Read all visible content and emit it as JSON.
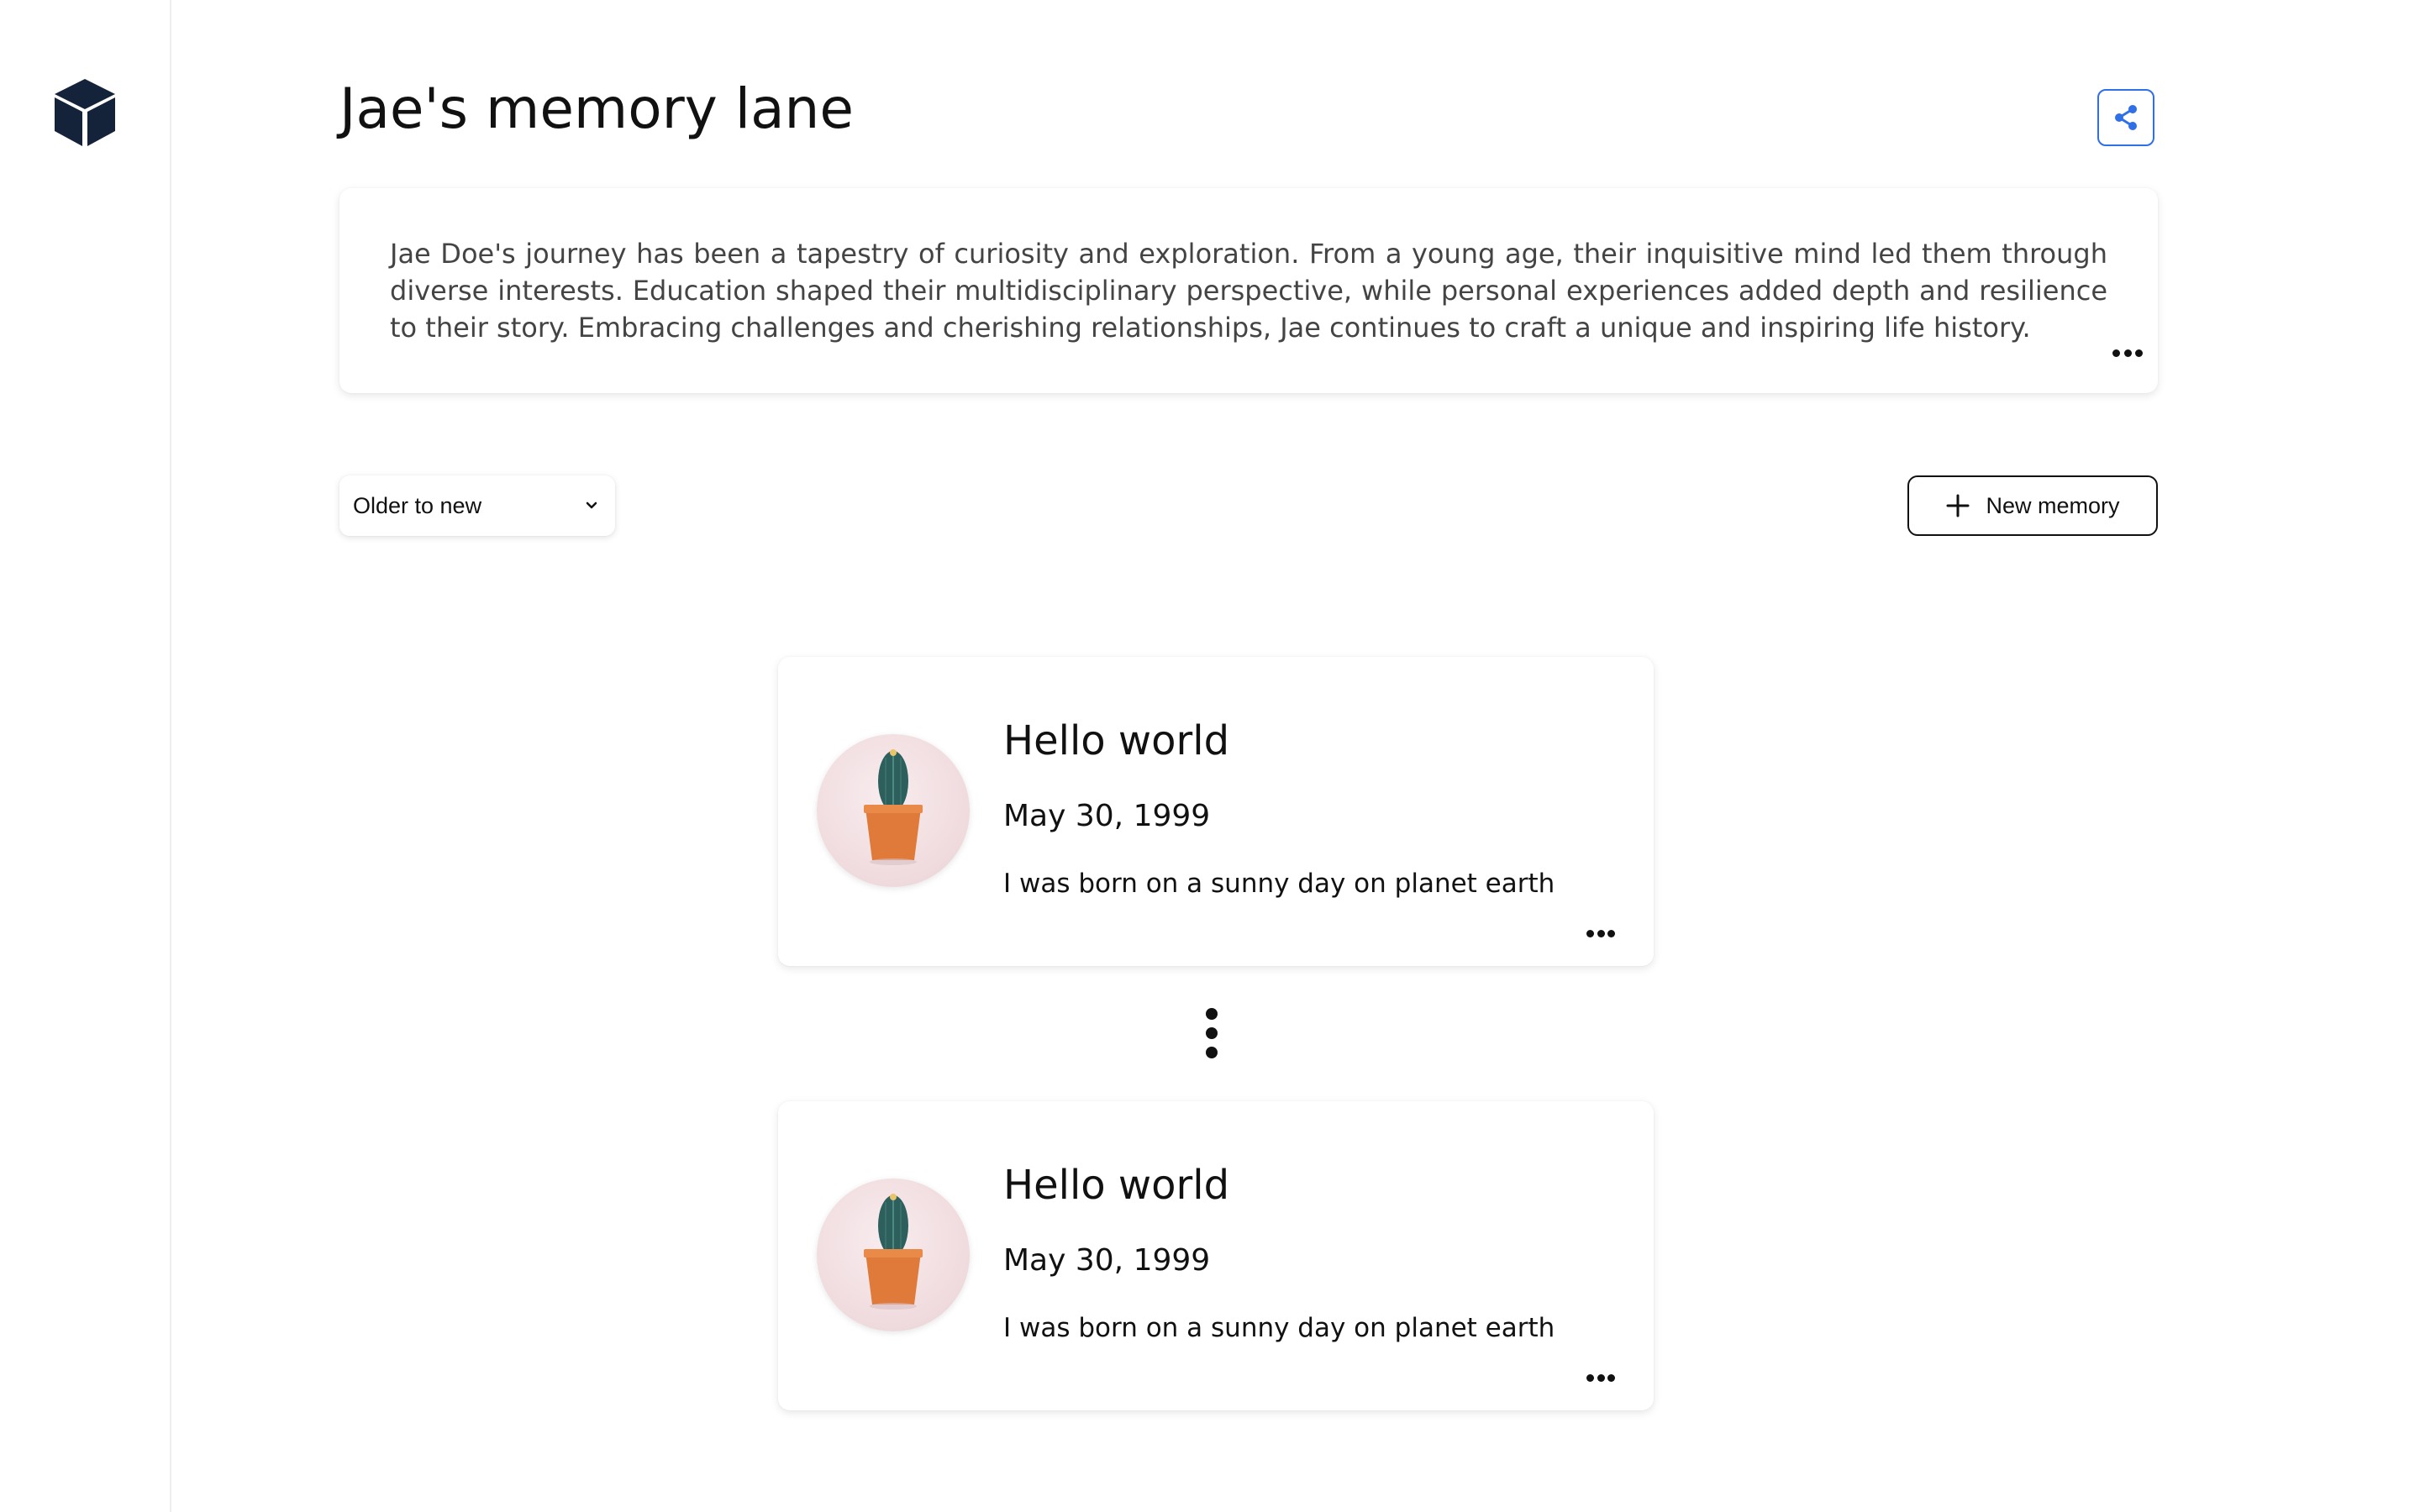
{
  "app": {
    "logo_icon": "cube-icon"
  },
  "header": {
    "title": "Jae's memory lane",
    "share_icon": "share-icon",
    "share_color": "#2f6fe8"
  },
  "bio": {
    "text": "Jae Doe's journey has been a tapestry of curiosity and exploration. From a young age, their inquisitive mind led them through diverse interests. Education shaped their multidisciplinary perspective, while personal experiences added depth and resilience to their story. Embracing challenges and cherishing relationships, Jae continues to craft a unique and inspiring life history.",
    "more_icon": "more-horizontal-icon"
  },
  "controls": {
    "sort": {
      "selected": "Older to new",
      "icon": "chevron-down-icon"
    },
    "new_memory": {
      "label": "New memory",
      "icon": "plus-icon"
    }
  },
  "memories": [
    {
      "title": "Hello world",
      "date": "May 30, 1999",
      "description": "I was born on a sunny day on planet earth",
      "image": "cactus-pot-image",
      "more_icon": "more-horizontal-icon"
    },
    {
      "title": "Hello world",
      "date": "May 30, 1999",
      "description": "I was born on a sunny day on planet earth",
      "image": "cactus-pot-image",
      "more_icon": "more-horizontal-icon"
    }
  ],
  "timeline": {
    "connector_icon": "more-vertical-icon"
  }
}
